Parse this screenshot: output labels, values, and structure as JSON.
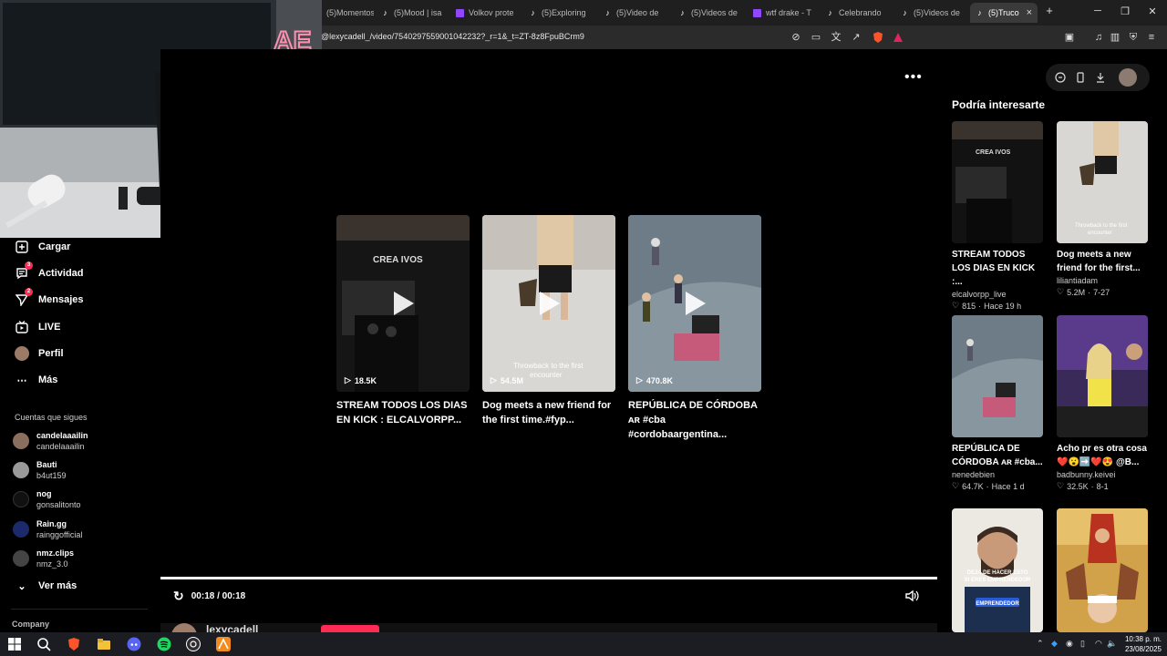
{
  "browser": {
    "tabs": [
      {
        "label": "(5)Momentos",
        "icon": "tiktok-icon"
      },
      {
        "label": "(5)Mood | isa",
        "icon": "tiktok-icon"
      },
      {
        "label": "Volkov prote",
        "icon": "twitch-icon"
      },
      {
        "label": "(5)Exploring",
        "icon": "tiktok-icon"
      },
      {
        "label": "(5)Video de",
        "icon": "tiktok-icon"
      },
      {
        "label": "(5)Videos de",
        "icon": "tiktok-icon"
      },
      {
        "label": "wtf drake - T",
        "icon": "twitch-icon"
      },
      {
        "label": "Celebrando",
        "icon": "tiktok-icon"
      },
      {
        "label": "(5)Videos de",
        "icon": "tiktok-icon"
      },
      {
        "label": "(5)Truco",
        "icon": "tiktok-icon"
      }
    ],
    "url": "@lexycadell_/video/7540297559001042232?_r=1&_t=ZT-8z8FpuBCrm9"
  },
  "sidebar": {
    "nav": [
      {
        "label": "Cargar",
        "icon": "upload-icon"
      },
      {
        "label": "Actividad",
        "icon": "activity-icon",
        "badge": "3"
      },
      {
        "label": "Mensajes",
        "icon": "messages-icon",
        "badge": "2"
      },
      {
        "label": "LIVE",
        "icon": "live-icon"
      },
      {
        "label": "Perfil",
        "icon": "profile-avatar"
      },
      {
        "label": "Más",
        "icon": "more-icon"
      }
    ],
    "following_heading": "Cuentas que sigues",
    "following": [
      {
        "name": "candelaaailin",
        "handle": "candelaaailin",
        "color": "#8a6f5e"
      },
      {
        "name": "Bauti",
        "handle": "b4ut159",
        "color": "#9a9a9a"
      },
      {
        "name": "nog",
        "handle": "gonsalitonto",
        "color": "#111111"
      },
      {
        "name": "Rain.gg",
        "handle": "rainggofficial",
        "color": "#1c2a6b"
      },
      {
        "name": "nmz.clips",
        "handle": "nmz_3.0",
        "color": "#444444"
      }
    ],
    "see_more": "Ver más",
    "company": "Company"
  },
  "main": {
    "cards": [
      {
        "views": "18.5K",
        "title": "STREAM TODOS LOS DIAS EN KICK : ELCALVORPP..."
      },
      {
        "views": "54.5M",
        "title": "Dog meets a new friend for the first time.#fyp..."
      },
      {
        "views": "470.8K",
        "title": "REPÚBLICA DE CÓRDOBA ᴀʀ #cba #cordobaargentina..."
      }
    ],
    "time": "00:18 / 00:18",
    "progress": 1.0,
    "author": "lexycadell"
  },
  "right": {
    "heading": "Podría interesarte",
    "items": [
      {
        "title": "STREAM TODOS LOS DIAS EN KICK :...",
        "author": "elcalvorpp_live",
        "likes": "815",
        "age": "Hace 19 h"
      },
      {
        "title": "Dog meets a new friend for the first...",
        "author": "liliantiadam",
        "likes": "5.2M",
        "age": "7-27"
      },
      {
        "title": "REPÚBLICA DE CÓRDOBA ᴀʀ #cba...",
        "author": "nenedebien",
        "likes": "64.7K",
        "age": "Hace 1 d"
      },
      {
        "title": "Acho pr es otra cosa ❤️😮➡️❤️😍 @B...",
        "author": "badbunny.keivei",
        "likes": "32.5K",
        "age": "8-1"
      },
      {
        "thumb_text": "DEJA DE HACER ESTO SI ERES EMPRENDEDOR",
        "thumb_label": "EMPRENDEDOR"
      },
      {
        "thumb_text": ""
      }
    ]
  },
  "taskbar": {
    "time": "10:38 p. m.",
    "date": "23/08/2025"
  }
}
